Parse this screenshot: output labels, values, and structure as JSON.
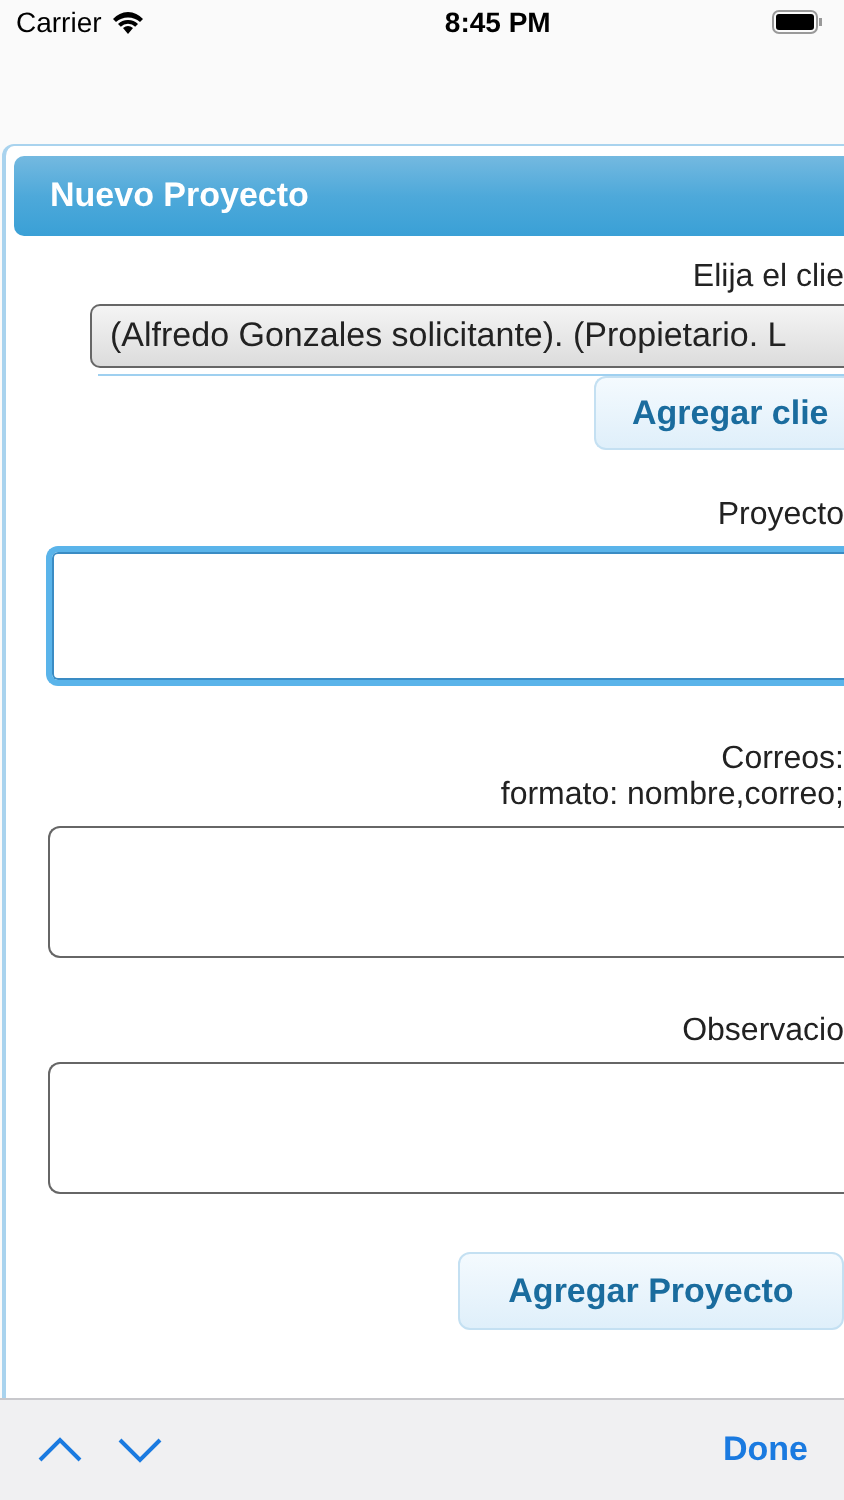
{
  "status_bar": {
    "carrier": "Carrier",
    "time": "8:45 PM"
  },
  "dialog": {
    "title": "Nuevo Proyecto",
    "client": {
      "label": "Elija el clie",
      "value": "(Alfredo Gonzales solicitante). (Propietario. L",
      "button": "Agregar clie"
    },
    "fields": [
      {
        "labels": [
          "Proyecto"
        ],
        "focused": true
      },
      {
        "labels": [
          "Correos:",
          "formato: nombre,correo;"
        ],
        "focused": false
      },
      {
        "labels": [
          "Observacio"
        ],
        "focused": false
      }
    ],
    "submit": "Agregar Proyecto"
  },
  "keyboard_toolbar": {
    "done": "Done"
  }
}
